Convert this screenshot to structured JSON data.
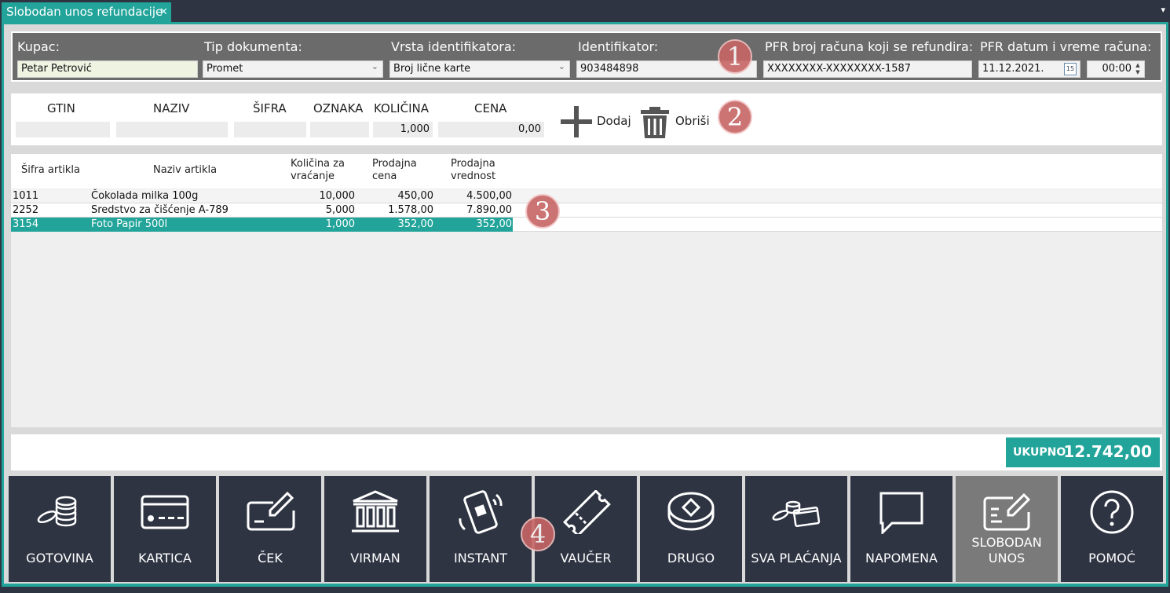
{
  "window": {
    "tab_title": "Slobodan unos refundacije",
    "tab_close": "✕",
    "menu_glyph": "▾"
  },
  "header": {
    "kupac_label": "Kupac:",
    "kupac_value": "Petar Petrović",
    "tip_label": "Tip dokumenta:",
    "tip_value": "Promet",
    "vrsta_label": "Vrsta identifikatora:",
    "vrsta_value": "Broj lične karte",
    "ident_label": "Identifikator:",
    "ident_value": "903484898",
    "pfr_broj_label": "PFR broj računa koji se refundira:",
    "pfr_broj_value": "XXXXXXXX-XXXXXXXX-1587",
    "pfr_datum_label": "PFR datum i vreme računa:",
    "pfr_datum_value": "11.12.2021.",
    "pfr_vreme_value": "00:00",
    "calendar_day": "15"
  },
  "badges": [
    "1",
    "2",
    "3",
    "4"
  ],
  "entry": {
    "gtin_label": "GTIN",
    "naziv_label": "NAZIV",
    "sifra_label": "ŠIFRA",
    "oznaka_label": "OZNAKA",
    "kolicina_label": "KOLIČINA",
    "cena_label": "CENA",
    "gtin_value": "",
    "naziv_value": "",
    "sifra_value": "",
    "oznaka_value": "",
    "kolicina_value": "1,000",
    "cena_value": "0,00",
    "dodaj_label": "Dodaj",
    "obrisi_label": "Obriši"
  },
  "grid": {
    "columns": [
      "Šifra artikla",
      "Naziv artikla",
      "Količina za vraćanje",
      "Prodajna cena",
      "Prodajna vrednost"
    ],
    "col_sifra": "Šifra artikla",
    "col_naziv": "Naziv artikla",
    "col_kol_1": "Količina za",
    "col_kol_2": "vraćanje",
    "col_cena_1": "Prodajna",
    "col_cena_2": "cena",
    "col_vred_1": "Prodajna",
    "col_vred_2": "vrednost",
    "rows": [
      {
        "sifra": "1011",
        "naziv": "Čokolada milka 100g",
        "kolicina": "10,000",
        "cena": "450,00",
        "vrednost": "4.500,00"
      },
      {
        "sifra": "2252",
        "naziv": "Sredstvo za čišćenje A-789",
        "kolicina": "5,000",
        "cena": "1.578,00",
        "vrednost": "7.890,00"
      },
      {
        "sifra": "3154",
        "naziv": "Foto Papir 500l",
        "kolicina": "1,000",
        "cena": "352,00",
        "vrednost": "352,00"
      }
    ],
    "selected_row": 2
  },
  "total": {
    "label": "UKUPNO",
    "value": "12.742,00"
  },
  "payments": [
    {
      "label": "GOTOVINA",
      "icon": "coins-icon"
    },
    {
      "label": "KARTICA",
      "icon": "card-icon"
    },
    {
      "label": "ČEK",
      "icon": "check-icon"
    },
    {
      "label": "VIRMAN",
      "icon": "bank-icon"
    },
    {
      "label": "INSTANT",
      "icon": "phone-qr-icon"
    },
    {
      "label": "VAUČER",
      "icon": "ticket-icon"
    },
    {
      "label": "DRUGO",
      "icon": "token-icon"
    },
    {
      "label": "SVA PLAĆANJA",
      "icon": "all-payments-icon"
    },
    {
      "label": "NAPOMENA",
      "icon": "speech-bubble-icon"
    },
    {
      "label": "SLOBODAN UNOS",
      "icon": "free-entry-icon",
      "line1": "SLOBODAN",
      "line2": "UNOS"
    },
    {
      "label": "POMOĆ",
      "icon": "help-icon"
    }
  ],
  "colors": {
    "accent": "#22a49a",
    "dark": "#2f3443",
    "header_gray": "#6b6b6b",
    "badge": "#c76565"
  }
}
